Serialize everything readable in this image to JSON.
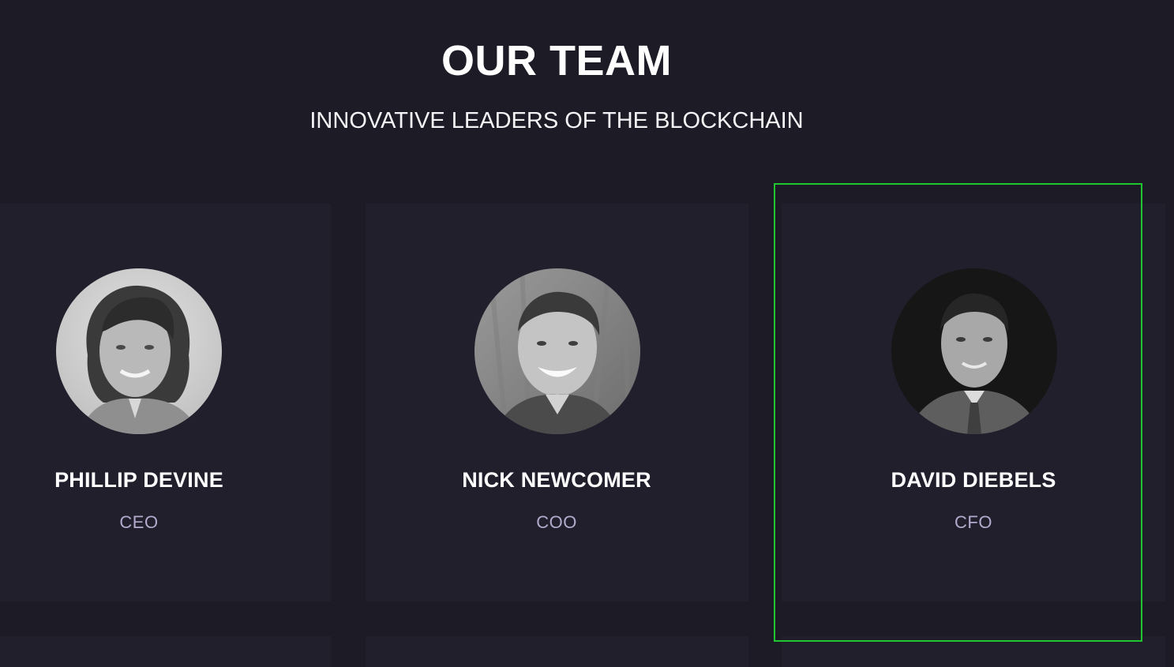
{
  "section": {
    "title": "OUR TEAM",
    "subtitle": "INNOVATIVE LEADERS OF THE BLOCKCHAIN"
  },
  "team": [
    {
      "name": "PHILLIP DEVINE",
      "role": "CEO"
    },
    {
      "name": "NICK NEWCOMER",
      "role": "COO"
    },
    {
      "name": "DAVID DIEBELS",
      "role": "CFO"
    }
  ],
  "colors": {
    "background": "#1c1b26",
    "card": "#211f2c",
    "name": "#ffffff",
    "role": "#b3aacd",
    "focus_outline": "#1fc630"
  }
}
